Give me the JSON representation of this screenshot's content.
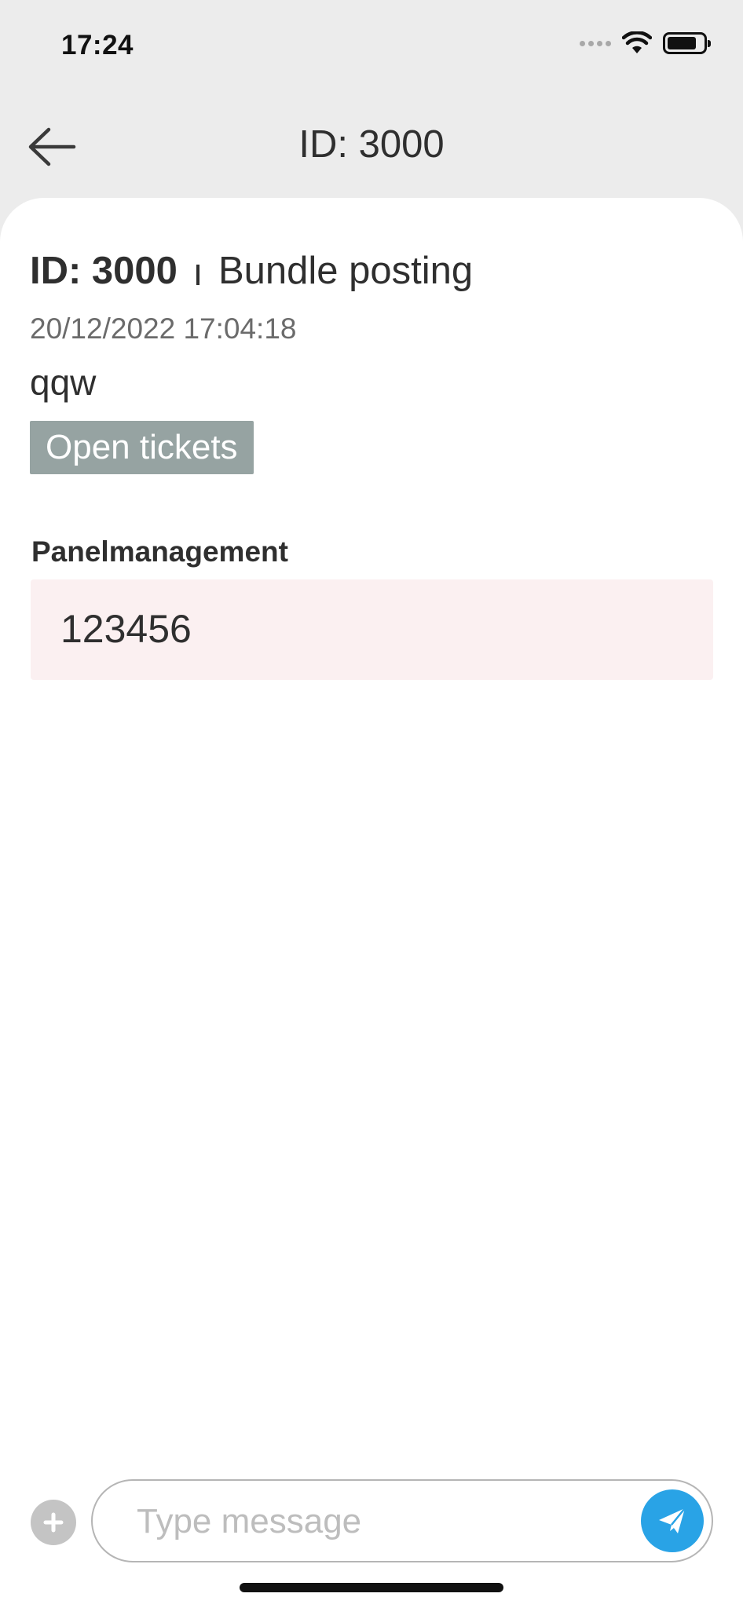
{
  "status_bar": {
    "time": "17:24",
    "icons": [
      "signal-dots-icon",
      "wifi-icon",
      "battery-icon"
    ]
  },
  "nav": {
    "back_icon": "arrow-left-icon",
    "title": "ID: 3000"
  },
  "ticket": {
    "id_label": "ID: 3000",
    "category": "Bundle posting",
    "date": "20/12/2022 17:04:18",
    "subject": "qqw",
    "status": "Open tickets",
    "status_color": "#96a3a2"
  },
  "field": {
    "label": "Panelmanagement",
    "value": "123456",
    "background": "#fbf0f1"
  },
  "composer": {
    "add_icon": "plus-icon",
    "placeholder": "Type message",
    "value": "",
    "send_icon": "paper-plane-icon",
    "send_color": "#29a3e6"
  }
}
